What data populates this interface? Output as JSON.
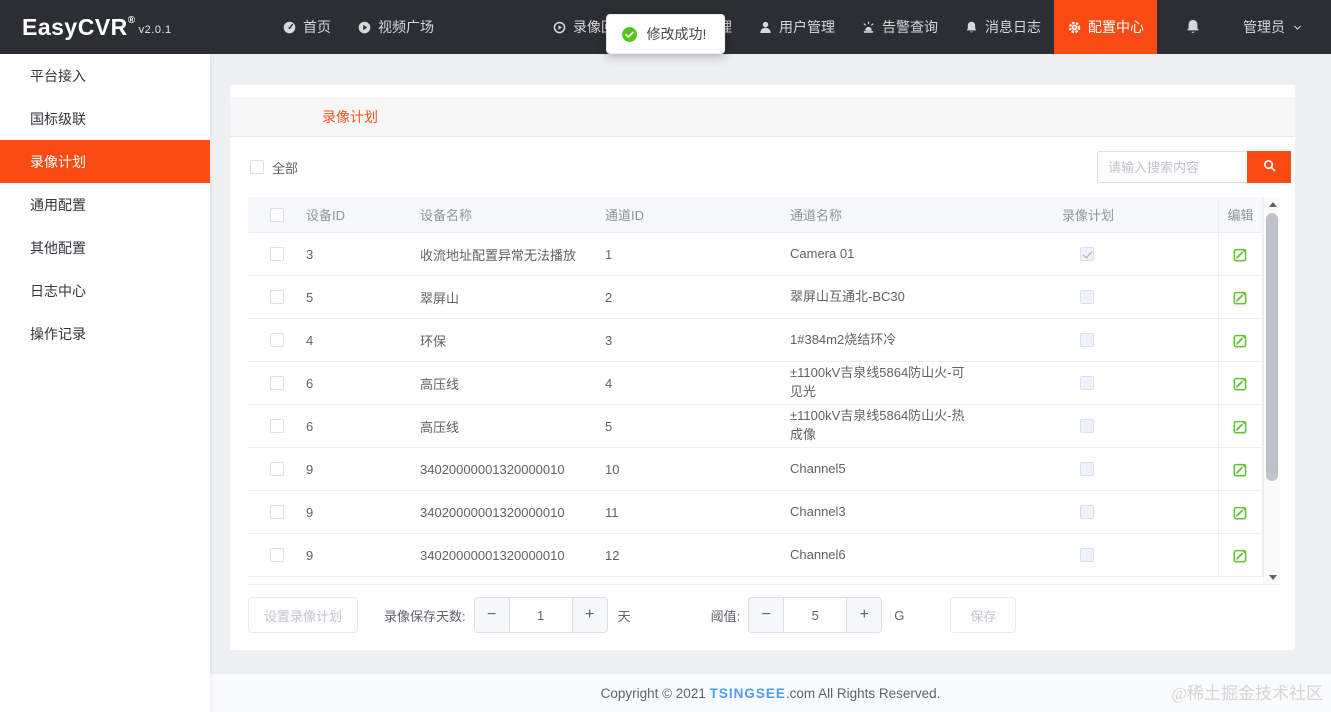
{
  "navbar": {
    "logo": "EasyCVR",
    "logo_sup": "®",
    "version": "v2.0.1",
    "items": [
      {
        "label": "首页",
        "icon": "dashboard-icon",
        "active": false
      },
      {
        "label": "视频广场",
        "icon": "play-circle-icon",
        "active": false
      },
      {
        "label": "录像回看",
        "icon": "playback-icon",
        "active": false
      },
      {
        "label": "设备管理",
        "icon": "device-icon",
        "active": false
      },
      {
        "label": "用户管理",
        "icon": "user-icon",
        "active": false
      },
      {
        "label": "告警查询",
        "icon": "alarm-icon",
        "active": false
      },
      {
        "label": "消息日志",
        "icon": "message-bell-icon",
        "active": false
      },
      {
        "label": "配置中心",
        "icon": "gear-icon",
        "active": true
      }
    ],
    "user": "管理员"
  },
  "toast": {
    "text": "修改成功!"
  },
  "sidebar": {
    "items": [
      {
        "label": "平台接入",
        "active": false
      },
      {
        "label": "国标级联",
        "active": false
      },
      {
        "label": "录像计划",
        "active": true
      },
      {
        "label": "通用配置",
        "active": false
      },
      {
        "label": "其他配置",
        "active": false
      },
      {
        "label": "日志中心",
        "active": false
      },
      {
        "label": "操作记录",
        "active": false
      }
    ]
  },
  "main": {
    "tab_title": "录像计划",
    "select_all_label": "全部",
    "search_placeholder": "请输入搜索内容",
    "table": {
      "headers": [
        "设备ID",
        "设备名称",
        "通道ID",
        "通道名称",
        "录像计划",
        "编辑"
      ],
      "rows": [
        {
          "device_id": "3",
          "device_name": "收流地址配置异常无法播放",
          "channel_id": "1",
          "channel_name": "Camera 01",
          "plan_checked": true
        },
        {
          "device_id": "5",
          "device_name": "翠屏山",
          "channel_id": "2",
          "channel_name": "翠屏山互通北-BC30",
          "plan_checked": false
        },
        {
          "device_id": "4",
          "device_name": "环保",
          "channel_id": "3",
          "channel_name": "1#384m2烧结环冷",
          "plan_checked": false
        },
        {
          "device_id": "6",
          "device_name": "高压线",
          "channel_id": "4",
          "channel_name": "±1100kV吉泉线5864防山火-可见光",
          "plan_checked": false
        },
        {
          "device_id": "6",
          "device_name": "高压线",
          "channel_id": "5",
          "channel_name": "±1100kV吉泉线5864防山火-热成像",
          "plan_checked": false
        },
        {
          "device_id": "9",
          "device_name": "34020000001320000010",
          "channel_id": "10",
          "channel_name": "Channel5",
          "plan_checked": false
        },
        {
          "device_id": "9",
          "device_name": "34020000001320000010",
          "channel_id": "11",
          "channel_name": "Channel3",
          "plan_checked": false
        },
        {
          "device_id": "9",
          "device_name": "34020000001320000010",
          "channel_id": "12",
          "channel_name": "Channel6",
          "plan_checked": false
        }
      ]
    },
    "footer_controls": {
      "set_plan_button": "设置录像计划",
      "retention_label": "录像保存天数:",
      "retention_value": "1",
      "retention_unit": "天",
      "threshold_label": "阈值:",
      "threshold_value": "5",
      "threshold_unit": "G",
      "save_button": "保存"
    }
  },
  "footer": {
    "copyright_prefix": "Copyright © 2021 ",
    "brand": "TSINGSEE",
    "copyright_suffix": ".com All Rights Reserved."
  },
  "watermark": "@稀土掘金技术社区",
  "colors": {
    "accent": "#fb4b14",
    "navbar": "#2b2e33",
    "edit_green": "#67c23a",
    "toast_green": "#52c41a",
    "brand_blue": "#4e9cf5"
  }
}
